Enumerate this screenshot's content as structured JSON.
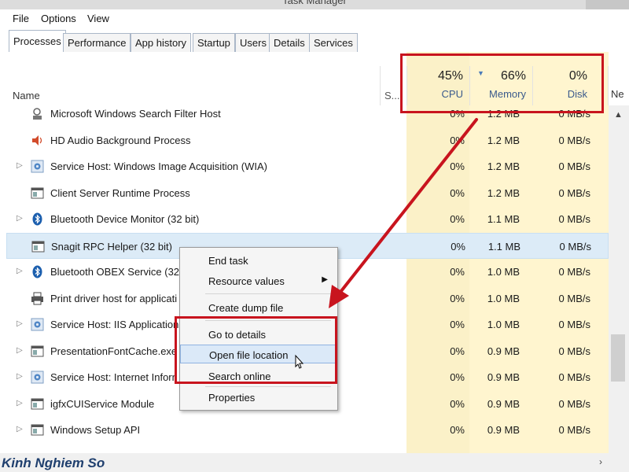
{
  "window": {
    "title": "Task Manager"
  },
  "menu": [
    "File",
    "Options",
    "View"
  ],
  "tabs": [
    "Processes",
    "Performance",
    "App history",
    "Startup",
    "Users",
    "Details",
    "Services"
  ],
  "columns": {
    "name": "Name",
    "status": "S...",
    "cpu": {
      "percent": "45%",
      "label": "CPU"
    },
    "memory": {
      "percent": "66%",
      "label": "Memory"
    },
    "disk": {
      "percent": "0%",
      "label": "Disk"
    },
    "network_partial": "Ne"
  },
  "processes": [
    {
      "name": "Microsoft Windows Search Filter Host",
      "cpu": "0%",
      "memory": "1.2 MB",
      "disk": "0 MB/s",
      "expandable": false,
      "icon": "search-filter-icon"
    },
    {
      "name": "HD Audio Background Process",
      "cpu": "0%",
      "memory": "1.2 MB",
      "disk": "0 MB/s",
      "expandable": false,
      "icon": "speaker-icon"
    },
    {
      "name": "Service Host: Windows Image Acquisition (WIA)",
      "cpu": "0%",
      "memory": "1.2 MB",
      "disk": "0 MB/s",
      "expandable": true,
      "icon": "service-gear-icon"
    },
    {
      "name": "Client Server Runtime Process",
      "cpu": "0%",
      "memory": "1.2 MB",
      "disk": "0 MB/s",
      "expandable": false,
      "icon": "window-app-icon"
    },
    {
      "name": "Bluetooth Device Monitor (32 bit)",
      "cpu": "0%",
      "memory": "1.1 MB",
      "disk": "0 MB/s",
      "expandable": true,
      "icon": "bluetooth-icon"
    },
    {
      "name": "Snagit RPC Helper (32 bit)",
      "cpu": "0%",
      "memory": "1.1 MB",
      "disk": "0 MB/s",
      "expandable": false,
      "icon": "window-app-icon",
      "selected": true
    },
    {
      "name": "Bluetooth OBEX Service (32 b",
      "cpu": "0%",
      "memory": "1.0 MB",
      "disk": "0 MB/s",
      "expandable": true,
      "icon": "bluetooth-icon"
    },
    {
      "name": "Print driver host for applicati",
      "cpu": "0%",
      "memory": "1.0 MB",
      "disk": "0 MB/s",
      "expandable": false,
      "icon": "printer-icon"
    },
    {
      "name": "Service Host: IIS Application",
      "cpu": "0%",
      "memory": "1.0 MB",
      "disk": "0 MB/s",
      "expandable": true,
      "icon": "service-gear-icon"
    },
    {
      "name": "PresentationFontCache.exe",
      "cpu": "0%",
      "memory": "0.9 MB",
      "disk": "0 MB/s",
      "expandable": true,
      "icon": "window-app-icon"
    },
    {
      "name": "Service Host: Internet Inforn",
      "cpu": "0%",
      "memory": "0.9 MB",
      "disk": "0 MB/s",
      "expandable": true,
      "icon": "service-gear-icon"
    },
    {
      "name": "igfxCUIService Module",
      "cpu": "0%",
      "memory": "0.9 MB",
      "disk": "0 MB/s",
      "expandable": true,
      "icon": "window-app-icon"
    },
    {
      "name": "Windows Setup API",
      "cpu": "0%",
      "memory": "0.9 MB",
      "disk": "0 MB/s",
      "expandable": true,
      "icon": "window-app-icon"
    }
  ],
  "context_menu": {
    "end_task": "End task",
    "resource_values": "Resource values",
    "create_dump": "Create dump file",
    "go_to_details": "Go to details",
    "open_file_location": "Open file location",
    "search_online": "Search online",
    "properties": "Properties"
  },
  "watermark": "Kinh Nghiem So",
  "colors": {
    "highlight_red": "#c8141e",
    "column_tint": "#fbf1c8",
    "selection": "#dcebf7"
  }
}
